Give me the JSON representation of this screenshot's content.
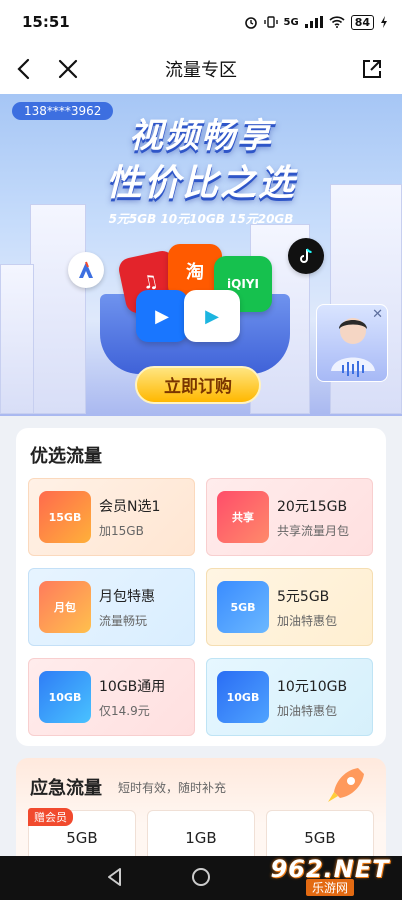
{
  "status": {
    "time": "15:51",
    "network": "5G",
    "battery": "84"
  },
  "nav": {
    "title": "流量专区"
  },
  "banner": {
    "phone": "138****3962",
    "headline1": "视频畅享",
    "headline2": "性价比之选",
    "subline": "5元5GB 10元10GB 15元20GB",
    "cta": "立即订购"
  },
  "featured": {
    "title": "优选流量",
    "tiles": [
      {
        "name": "会员N选1",
        "desc": "加15GB",
        "icon_text": "15GB"
      },
      {
        "name": "20元15GB",
        "desc": "共享流量月包",
        "icon_text": "共享"
      },
      {
        "name": "月包特惠",
        "desc": "流量畅玩",
        "icon_text": "月包"
      },
      {
        "name": "5元5GB",
        "desc": "加油特惠包",
        "icon_text": "5GB"
      },
      {
        "name": "10GB通用",
        "desc": "仅14.9元",
        "icon_text": "10GB"
      },
      {
        "name": "10元10GB",
        "desc": "加油特惠包",
        "icon_text": "10GB"
      }
    ]
  },
  "emergency": {
    "title": "应急流量",
    "subtitle": "短时有效，随时补充",
    "badge": "赠会员",
    "items": [
      {
        "value": "5GB"
      },
      {
        "value": "1GB"
      },
      {
        "value": "5GB"
      }
    ]
  },
  "watermark": {
    "line1": "962.NET",
    "line2": "乐游网"
  },
  "colors": {
    "accent": "#3d6fe0",
    "cta": "#ffb800",
    "badge": "#f14a2e"
  }
}
